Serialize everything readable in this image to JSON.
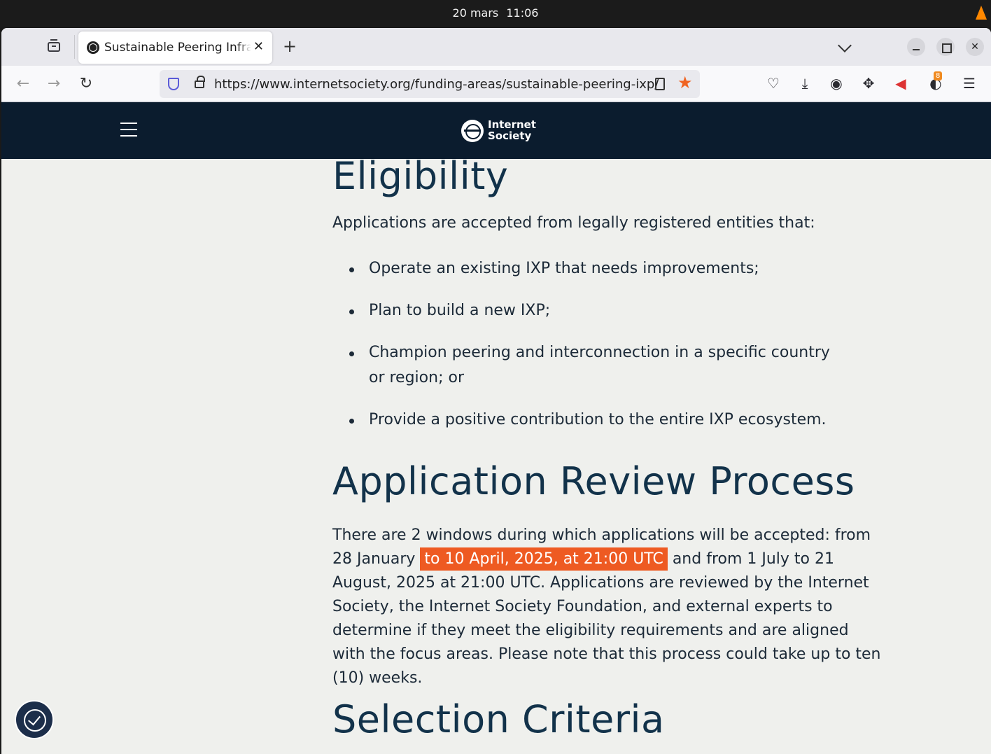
{
  "os": {
    "date": "20 mars",
    "time": "11:06"
  },
  "browser": {
    "tab_title": "Sustainable Peering Infrastructure",
    "url": "https://www.internetsociety.org/funding-areas/sustainable-peering-ixp/",
    "extension_badge": "8"
  },
  "site": {
    "logo_line1": "Internet",
    "logo_line2": "Society",
    "eligibility": {
      "heading": "Eligibility",
      "intro": "Applications are accepted from legally registered entities that:",
      "bullets": [
        "Operate an existing IXP that needs improvements;",
        "Plan to build a new IXP;",
        "Champion peering and interconnection in a specific country or region; or",
        "Provide a positive contribution to the entire IXP ecosystem."
      ]
    },
    "review": {
      "heading": "Application Review Process",
      "text_before": "There are 2 windows during which applications will be accepted: from 28 January",
      "text_highlight": "to 10 April, 2025, at 21:00 UTC",
      "text_after": "and from 1 July to 21 August, 2025 at 21:00 UTC. Applications are reviewed by the Internet Society, the Internet Society Foundation, and external experts to determine if they meet the eligibility requirements and are aligned with the focus areas. Please note that this process could take up to ten (10) weeks."
    },
    "selection": {
      "heading": "Selection Criteria"
    }
  },
  "colors": {
    "header_bg": "#0b1c2e",
    "highlight": "#ee5a22",
    "page_bg": "#eff0ed",
    "heading": "#12324a"
  }
}
